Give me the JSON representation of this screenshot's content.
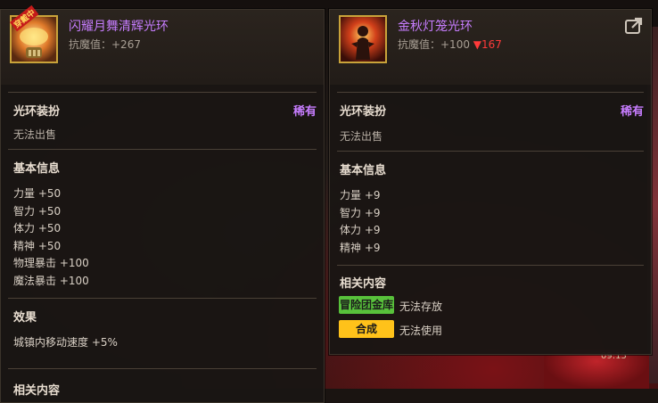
{
  "left_tooltip": {
    "item_name": "闪耀月舞清辉光环",
    "new_tag": "穿戴中",
    "resistance": "抗魔值：+267",
    "category": "光环装扮",
    "rarity": "稀有",
    "trade": "无法出售",
    "basic_info_title": "基本信息",
    "stats": [
      "力量 +50",
      "智力 +50",
      "体力 +50",
      "精神 +50",
      "物理暴击 +100",
      "魔法暴击 +100"
    ],
    "effect_title": "效果",
    "effect_text": "城镇内移动速度 +5%",
    "related_title": "相关内容"
  },
  "right_tooltip": {
    "item_name": "金秋灯笼光环",
    "resistance": "抗魔值：+100",
    "resistance_delta": "▼167",
    "category": "光环装扮",
    "rarity": "稀有",
    "trade": "无法出售",
    "basic_info_title": "基本信息",
    "stats": [
      "力量 +9",
      "智力 +9",
      "体力 +9",
      "精神 +9"
    ],
    "related_title": "相关内容",
    "related": [
      {
        "button": "冒险团金库",
        "status": "无法存放"
      },
      {
        "button": "合成",
        "status": "无法使用"
      }
    ]
  },
  "background": {
    "timer_text": "09:15"
  },
  "colors": {
    "rarity_purple": "#c77dff",
    "delta_red": "#ff3a3a",
    "button_green": "#58c13b",
    "button_yellow": "#ffc21a"
  }
}
